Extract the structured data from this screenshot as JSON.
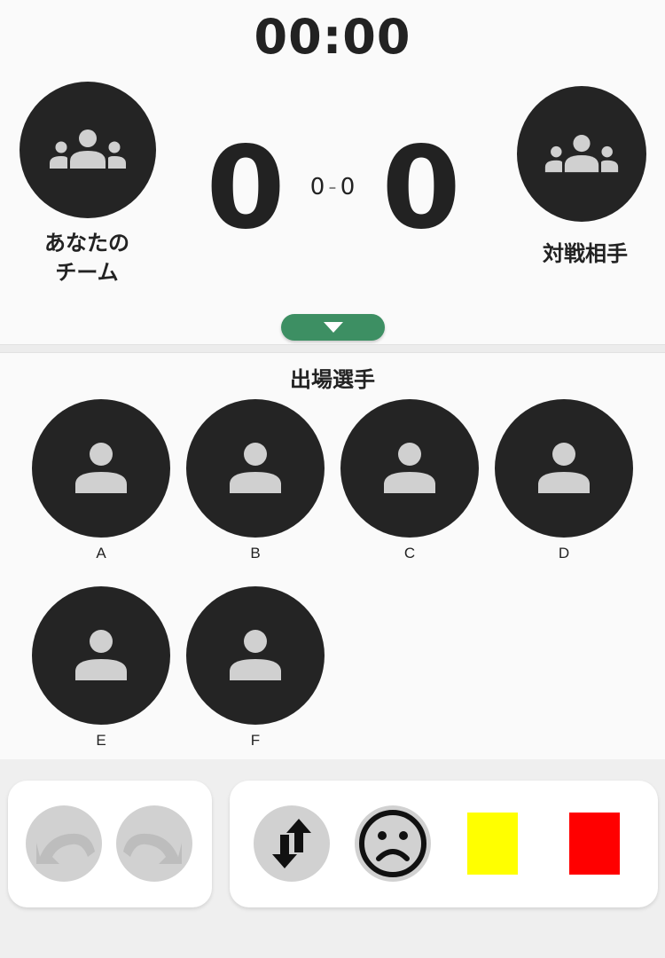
{
  "timer": "00:00",
  "home_team": {
    "name_line1": "あなたの",
    "name_line2": "チーム",
    "score": "0",
    "avatar_icon": "group-icon"
  },
  "away_team": {
    "name": "対戦相手",
    "score": "0",
    "avatar_icon": "group-icon"
  },
  "set_score": {
    "home": "0",
    "separator": "-",
    "away": "0"
  },
  "toggle": {
    "icon": "triangle-down-icon",
    "color": "#3d8f63"
  },
  "players_section": {
    "title": "出場選手",
    "players": [
      {
        "label": "A"
      },
      {
        "label": "B"
      },
      {
        "label": "C"
      },
      {
        "label": "D"
      },
      {
        "label": "E"
      },
      {
        "label": "F"
      }
    ]
  },
  "toolbar": {
    "undo_icon": "undo-icon",
    "redo_icon": "redo-icon",
    "substitution_icon": "swap-vertical-icon",
    "sad_face_icon": "sad-face-icon",
    "yellow_card_color": "#ffff00",
    "red_card_color": "#ff0000"
  }
}
